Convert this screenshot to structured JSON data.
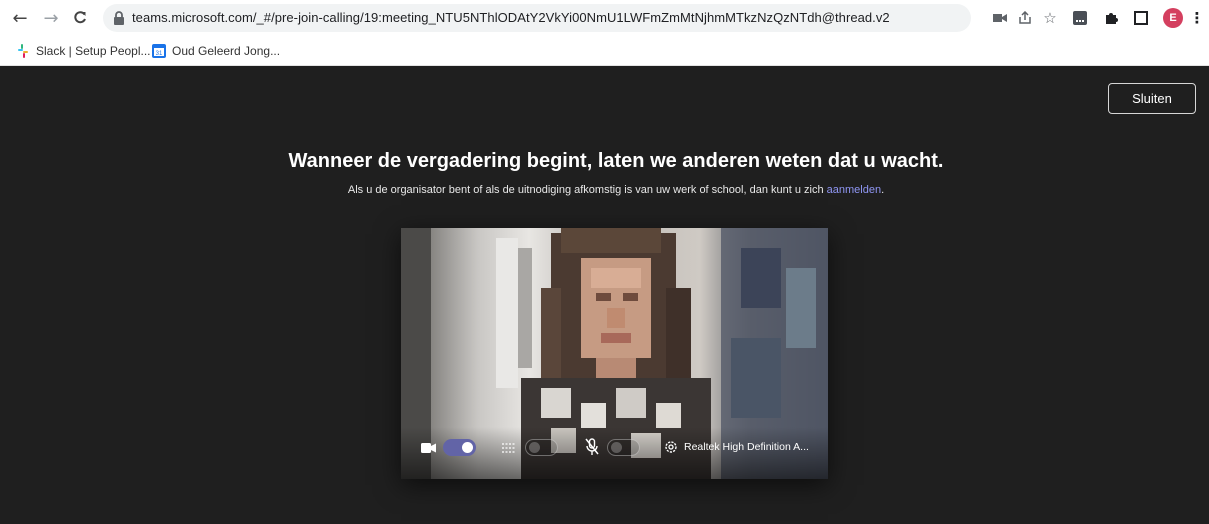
{
  "browser": {
    "url": "teams.microsoft.com/_#/pre-join-calling/19:meeting_NTU5NThlODAtY2VkYi00NmU1LWFmZmMtNjhmMTkzNzQzNTdh@thread.v2",
    "profile_initial": "E",
    "bookmarks": [
      {
        "label": "Slack | Setup Peopl...",
        "icon": "slack-icon"
      },
      {
        "label": "Oud Geleerd Jong...",
        "icon": "calendar-icon"
      }
    ]
  },
  "page": {
    "close_button": "Sluiten",
    "headline": "Wanneer de vergadering begint, laten we anderen weten dat u wacht.",
    "subline_text": "Als u de organisator bent of als de uitnodiging afkomstig is van uw werk of school, dan kunt u zich ",
    "subline_link": "aanmelden",
    "subline_end": "."
  },
  "controls": {
    "camera_on": true,
    "background_blur_on": false,
    "microphone_on": false,
    "audio_device": "Realtek High Definition A..."
  },
  "colors": {
    "accent": "#6264a7",
    "link": "#8f96f3",
    "page_background": "#1f1f1f",
    "profile_avatar": "#d43f5f"
  }
}
